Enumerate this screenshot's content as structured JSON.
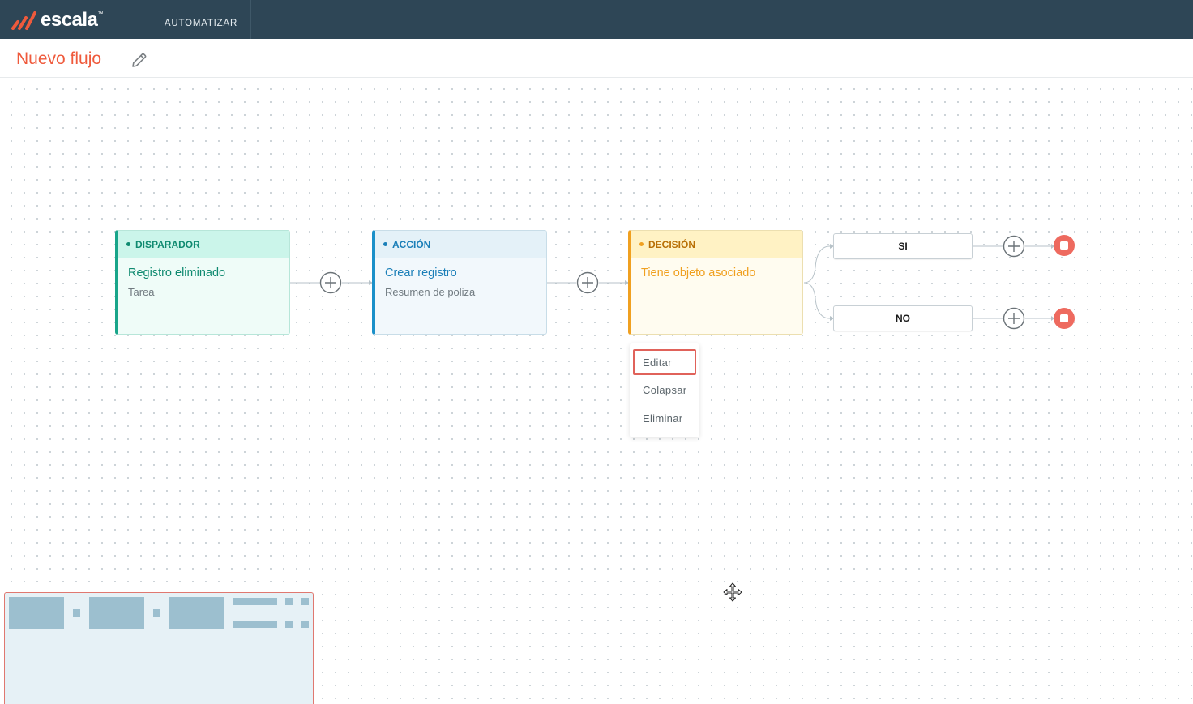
{
  "header": {
    "brand": "escala",
    "brand_tm": "™",
    "nav": [
      {
        "label": "AUTOMATIZAR"
      }
    ]
  },
  "page": {
    "title": "Nuevo flujo"
  },
  "flow": {
    "nodes": [
      {
        "type": "DISPARADOR",
        "title": "Registro eliminado",
        "subtitle": "Tarea"
      },
      {
        "type": "ACCIÓN",
        "title": "Crear registro",
        "subtitle": "Resumen de poliza"
      },
      {
        "type": "DECISIÓN",
        "title": "Tiene objeto asociado",
        "subtitle": ""
      }
    ],
    "branches": [
      {
        "label": "SI"
      },
      {
        "label": "NO"
      }
    ]
  },
  "context_menu": {
    "items": [
      {
        "label": "Editar",
        "selected": true
      },
      {
        "label": "Colapsar",
        "selected": false
      },
      {
        "label": "Eliminar",
        "selected": false
      }
    ]
  },
  "colors": {
    "header_bg": "#2e4656",
    "brand_accent": "#ef5a3c",
    "trigger": "#19a58a",
    "action": "#1b90c9",
    "decision": "#f0a020",
    "stop": "#ee6a5f"
  },
  "icons": {
    "edit_title": "pencil-icon",
    "add_step": "plus-circle-icon",
    "end_flow": "stop-icon",
    "cursor": "move-cursor-icon"
  }
}
